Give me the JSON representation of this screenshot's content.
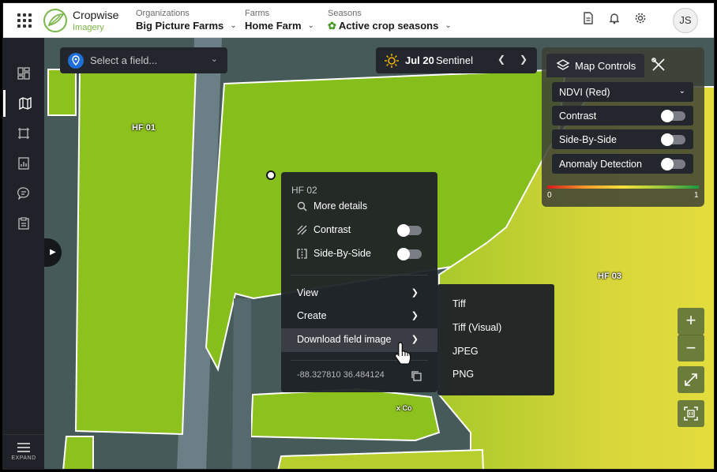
{
  "header": {
    "brand_name": "Cropwise",
    "brand_product": "Imagery",
    "organization": {
      "label": "Organizations",
      "value": "Big Picture Farms"
    },
    "farm": {
      "label": "Farms",
      "value": "Home Farm"
    },
    "season": {
      "label": "Seasons",
      "value": "Active crop seasons"
    },
    "icons": [
      "document-icon",
      "bell-icon",
      "gear-icon"
    ],
    "avatar_initials": "JS"
  },
  "sidebar": {
    "items": [
      "dashboard-icon",
      "map-icon",
      "crop-field-icon",
      "report-icon",
      "chat-icon",
      "clipboard-icon"
    ],
    "active_index": 1,
    "expand_label": "EXPAND"
  },
  "map": {
    "field_labels": [
      "HF 01",
      "HF 03"
    ],
    "obscured_label": "x Co"
  },
  "field_select": {
    "placeholder": "Select a field..."
  },
  "datebar": {
    "date": "Jul 20",
    "source": "Sentinel"
  },
  "map_controls": {
    "tab_label": "Map Controls",
    "layer": "NDVI (Red)",
    "toggles": [
      {
        "label": "Contrast",
        "on": false
      },
      {
        "label": "Side-By-Side",
        "on": false
      },
      {
        "label": "Anomaly Detection",
        "on": false
      }
    ],
    "scale_min": "0",
    "scale_max": "1"
  },
  "context_menu": {
    "title": "HF 02",
    "more_details": "More details",
    "contrast": "Contrast",
    "side_by_side": "Side-By-Side",
    "view": "View",
    "create": "Create",
    "download": "Download field image",
    "coordinates": "-88.327810 36.484124"
  },
  "download_submenu": [
    "Tiff",
    "Tiff (Visual)",
    "JPEG",
    "PNG"
  ],
  "map_buttons": {
    "zoom_in": "+",
    "zoom_out": "−"
  },
  "colors": {
    "accent_green": "#7ab648",
    "ndvi_low": "#d7191c",
    "ndvi_high": "#1a9641"
  }
}
